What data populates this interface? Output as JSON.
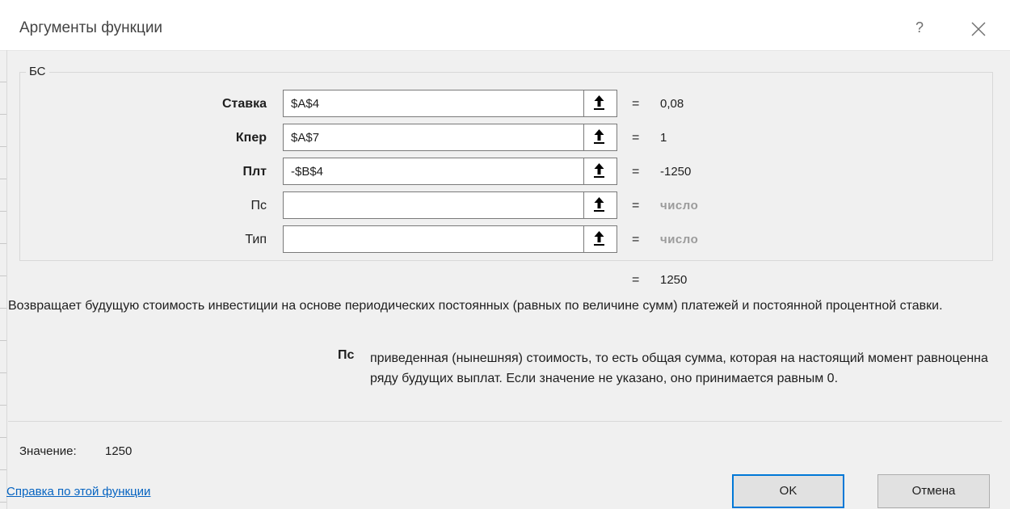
{
  "window": {
    "title": "Аргументы функции",
    "help_glyph": "?",
    "close_icon": "close-x-icon"
  },
  "function": {
    "name": "БС",
    "args": [
      {
        "label": "Ставка",
        "value": "$A$4",
        "result": "0,08",
        "required": true
      },
      {
        "label": "Кпер",
        "value": "$A$7",
        "result": "1",
        "required": true
      },
      {
        "label": "Плт",
        "value": "-$B$4",
        "result": "-1250",
        "required": true
      },
      {
        "label": "Пс",
        "value": "",
        "result": "число",
        "required": false
      },
      {
        "label": "Тип",
        "value": "",
        "result": "число",
        "required": false
      }
    ],
    "equals_sign": "=",
    "formula_result": "1250",
    "description": "Возвращает будущую стоимость инвестиции на основе периодических постоянных (равных по величине сумм) платежей и постоянной процентной ставки.",
    "param_name": "Пс",
    "param_description": "приведенная (нынешняя) стоимость, то есть общая сумма, которая на настоящий момент равноценна ряду будущих выплат. Если значение не указано, оно принимается равным 0."
  },
  "footer": {
    "value_label": "Значение:",
    "value": "1250",
    "help_link": "Справка по этой функции",
    "ok_label": "OK",
    "cancel_label": "Отмена"
  },
  "colors": {
    "link": "#0563c1",
    "ok_border": "#0078d7",
    "hint_text": "#9b9b9b"
  }
}
